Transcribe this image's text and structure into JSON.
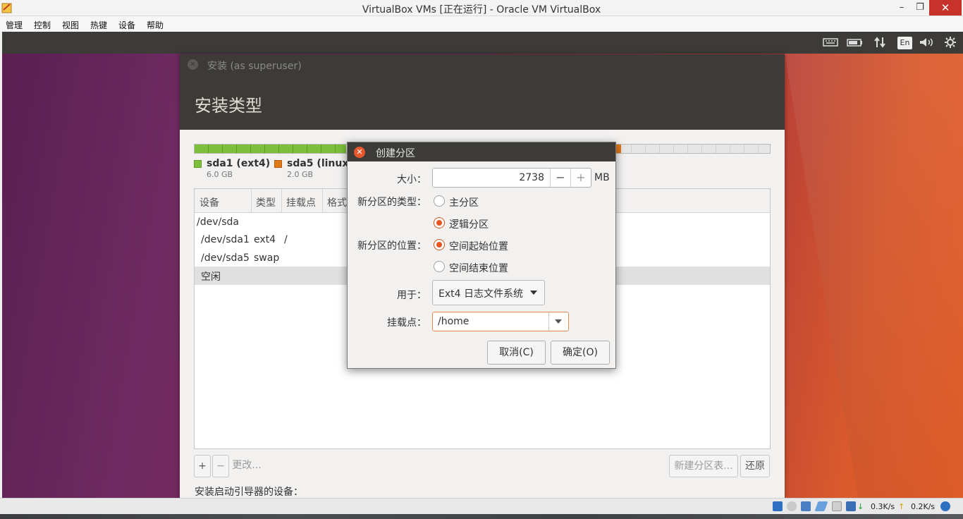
{
  "host": {
    "title": "VirtualBox VMs [正在运行] - Oracle VM VirtualBox",
    "controls": {
      "minimize": "–",
      "maximize": "❐",
      "close": "✕"
    },
    "menu": [
      "管理",
      "控制",
      "视图",
      "热键",
      "设备",
      "帮助"
    ]
  },
  "guest_panel": {
    "keyboard_layout": "En",
    "icons": [
      "keyboard-icon",
      "battery-icon",
      "network-icon",
      "language-icon",
      "volume-icon",
      "settings-icon"
    ]
  },
  "installer": {
    "window_title": "安装 (as superuser)",
    "heading": "安装类型",
    "legend": [
      {
        "name": "sda1 (ext4)",
        "size": "6.0 GB",
        "color": "#7bbf3a"
      },
      {
        "name": "sda5 (linux-s",
        "size": "2.0 GB",
        "color": "#e07a18"
      }
    ],
    "table": {
      "columns": [
        "设备",
        "类型",
        "挂载点",
        "格式"
      ],
      "rows": [
        {
          "device": "/dev/sda",
          "type": "",
          "mount": ""
        },
        {
          "device": "/dev/sda1",
          "type": "ext4",
          "mount": "/"
        },
        {
          "device": "/dev/sda5",
          "type": "swap",
          "mount": ""
        },
        {
          "device": "空闲",
          "type": "",
          "mount": ""
        }
      ]
    },
    "toolbar": {
      "add": "+",
      "remove": "−",
      "change": "更改...",
      "new_table": "新建分区表...",
      "revert": "还原"
    },
    "boot_loader_label": "安装启动引导器的设备："
  },
  "dialog": {
    "title": "创建分区",
    "size_label": "大小：",
    "size_value": "2738",
    "size_unit": "MB",
    "minus": "−",
    "plus": "+",
    "type_label": "新分区的类型：",
    "type_options": [
      "主分区",
      "逻辑分区"
    ],
    "type_selected": "逻辑分区",
    "location_label": "新分区的位置：",
    "location_options": [
      "空间起始位置",
      "空间结束位置"
    ],
    "location_selected": "空间起始位置",
    "use_label": "用于：",
    "use_value": "Ext4 日志文件系统",
    "mount_label": "挂载点：",
    "mount_value": "/home",
    "cancel": "取消(C)",
    "ok": "确定(O)"
  },
  "taskbar": {
    "download_speed": "0.3K/s",
    "upload_speed": "0.2K/s"
  }
}
